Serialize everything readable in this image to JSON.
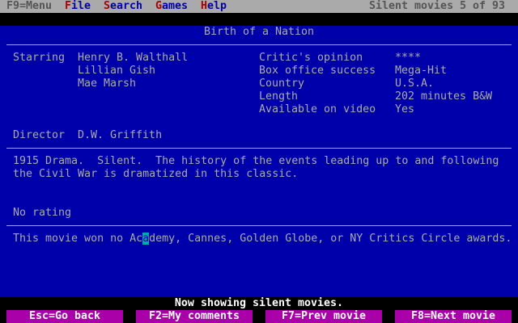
{
  "menu": {
    "f9": "F9=Menu",
    "items": [
      {
        "hotkey": "F",
        "rest": "ile"
      },
      {
        "hotkey": "S",
        "rest": "earch"
      },
      {
        "hotkey": "G",
        "rest": "ames"
      },
      {
        "hotkey": "H",
        "rest": "elp"
      }
    ],
    "category": "Silent movies",
    "position": "5 of 93"
  },
  "movie": {
    "title": "Birth of a Nation",
    "starring_label": "Starring",
    "stars": [
      "Henry B. Walthall",
      "Lillian Gish",
      "Mae Marsh"
    ],
    "facts": [
      {
        "label": "Critic's opinion",
        "value": "****"
      },
      {
        "label": "Box office success",
        "value": "Mega-Hit"
      },
      {
        "label": "Country",
        "value": "U.S.A."
      },
      {
        "label": "Length",
        "value": "202 minutes B&W"
      },
      {
        "label": "Available on video",
        "value": "Yes"
      }
    ],
    "director_label": "Director",
    "director": "D.W. Griffith",
    "description": [
      "1915 Drama.  Silent.  The history of the events leading up to and following",
      "the Civil War is dramatized in this classic."
    ],
    "rating": "No rating",
    "awards_before": "This movie won no Ac",
    "awards_cursor": "a",
    "awards_after": "demy, Cannes, Golden Globe, or NY Critics Circle awards."
  },
  "status": "Now showing silent movies.",
  "buttons": [
    "Esc=Go back",
    "F2=My comments",
    "F7=Prev movie",
    "F8=Next movie"
  ]
}
